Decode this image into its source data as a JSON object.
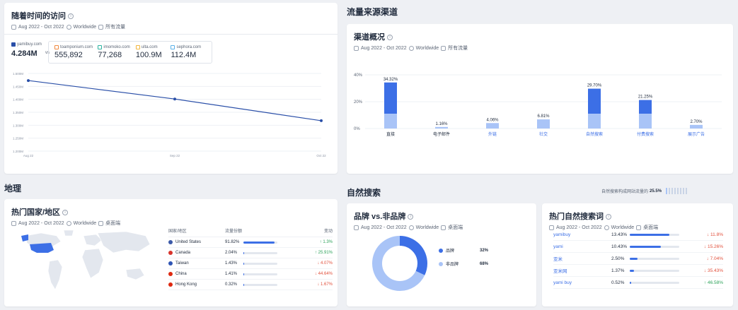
{
  "visits": {
    "title": "随着时间的访问",
    "date_range": "Aug 2022 - Oct 2022",
    "region": "Worldwide",
    "traffic": "所有流量",
    "main_site": {
      "name": "yamibuy.com",
      "value": "4.284M",
      "color": "#2a4fa8"
    },
    "vs": "vs",
    "competitors": [
      {
        "name": "toamponium.com",
        "value": "555,892",
        "color": "#f0883e"
      },
      {
        "name": "imomoko.com",
        "value": "77,268",
        "color": "#2bb3a0"
      },
      {
        "name": "ulta.com",
        "value": "100.9M",
        "color": "#f2b63d"
      },
      {
        "name": "sephora.com",
        "value": "112.4M",
        "color": "#5ab0e8"
      }
    ],
    "y_ticks": [
      "1.500M",
      "1.450M",
      "1.400M",
      "1.350M",
      "1.300M",
      "1.250M",
      "1.200M"
    ],
    "x_ticks": [
      "Aug 22",
      "Sep 22",
      "Oct 22"
    ],
    "chart_data": {
      "type": "line",
      "x": [
        "Aug 22",
        "Sep 22",
        "Oct 22"
      ],
      "series": [
        {
          "name": "yamibuy.com",
          "values": [
            1.478,
            1.421,
            1.354
          ]
        }
      ],
      "ylim": [
        1.26,
        1.5
      ]
    }
  },
  "traffic_sources": {
    "section_title": "流量来源渠道",
    "card_title": "渠道概况",
    "date_range": "Aug 2022 - Oct 2022",
    "region": "Worldwide",
    "traffic": "所有流量",
    "y_ticks": [
      "40%",
      "20%",
      "0%"
    ],
    "chart_data": {
      "type": "bar",
      "categories": [
        "直接",
        "电子邮件",
        "外链",
        "社交",
        "自然搜索",
        "付费搜索",
        "展示广告"
      ],
      "values": [
        34.32,
        1.16,
        4.06,
        6.81,
        29.7,
        21.25,
        2.7
      ],
      "value_labels": [
        "34.32%",
        "1.16%",
        "4.06%",
        "6.81%",
        "29.70%",
        "21.25%",
        "2.70%"
      ],
      "ylim": [
        0,
        40
      ],
      "colors": {
        "dark": "#3c6fe6",
        "light": "#a9c4f7"
      }
    }
  },
  "geo": {
    "section_title": "地理",
    "card_title": "热门国家/地区",
    "date_range": "Aug 2022 - Oct 2022",
    "region": "Worldwide",
    "device": "桌面端",
    "columns": [
      "国家/地区",
      "流量份额",
      "变动"
    ],
    "rows": [
      {
        "country": "United States",
        "share": "91.82%",
        "share_pct": 91.82,
        "change": "1.3%",
        "dir": "up",
        "flag_color": "#3c5aa8"
      },
      {
        "country": "Canada",
        "share": "2.04%",
        "share_pct": 2.04,
        "change": "25.91%",
        "dir": "up",
        "flag_color": "#d8342c"
      },
      {
        "country": "Taiwan",
        "share": "1.43%",
        "share_pct": 1.43,
        "change": "4.07%",
        "dir": "down",
        "flag_color": "#2f55b4"
      },
      {
        "country": "China",
        "share": "1.41%",
        "share_pct": 1.41,
        "change": "44.64%",
        "dir": "down",
        "flag_color": "#de2910"
      },
      {
        "country": "Hong Kong",
        "share": "0.32%",
        "share_pct": 0.32,
        "change": "1.67%",
        "dir": "down",
        "flag_color": "#de2910"
      }
    ]
  },
  "organic": {
    "section_title": "自然搜索",
    "share_text": "自然搜索构成网站流量的",
    "share_value": "25.5%",
    "brand_card": {
      "title": "品牌 vs.非品牌",
      "date_range": "Aug 2022 - Oct 2022",
      "region": "Worldwide",
      "device": "桌面端",
      "legend": [
        {
          "label": "品牌",
          "value": "32%",
          "color": "#3c6fe6"
        },
        {
          "label": "非品牌",
          "value": "68%",
          "color": "#a9c4f7"
        }
      ],
      "chart_data": {
        "type": "pie",
        "categories": [
          "品牌",
          "非品牌"
        ],
        "values": [
          32,
          68
        ]
      }
    },
    "keywords_card": {
      "title": "热门自然搜索词",
      "date_range": "Aug 2022 - Oct 2022",
      "region": "Worldwide",
      "device": "桌面端",
      "rows": [
        {
          "term": "yamibuy",
          "share": "13.43%",
          "share_pct": 13.43,
          "change": "11.8%",
          "dir": "down"
        },
        {
          "term": "yami",
          "share": "10.43%",
          "share_pct": 10.43,
          "change": "15.26%",
          "dir": "down"
        },
        {
          "term": "亚米",
          "share": "2.50%",
          "share_pct": 2.5,
          "change": "7.04%",
          "dir": "down"
        },
        {
          "term": "亚米网",
          "share": "1.37%",
          "share_pct": 1.37,
          "change": "35.43%",
          "dir": "down"
        },
        {
          "term": "yami buy",
          "share": "0.52%",
          "share_pct": 0.52,
          "change": "46.58%",
          "dir": "up"
        }
      ]
    }
  }
}
